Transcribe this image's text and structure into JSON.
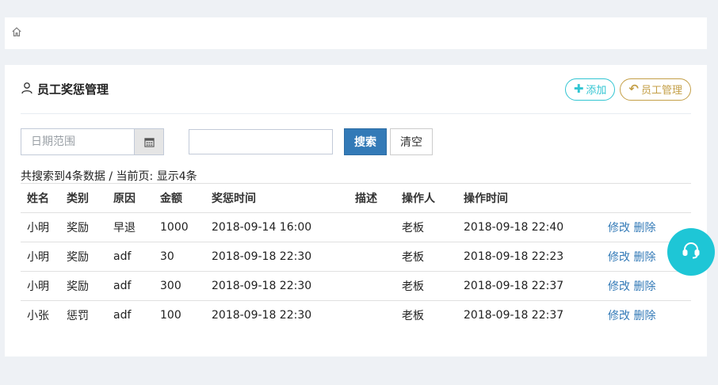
{
  "breadcrumb": {
    "home_icon": "home-icon"
  },
  "panel": {
    "title": "员工奖惩管理",
    "title_icon": "user-icon",
    "actions": {
      "add_label": "添加",
      "staff_label": "员工管理"
    }
  },
  "search": {
    "date_placeholder": "日期范围",
    "text_value": "",
    "search_label": "搜索",
    "clear_label": "清空"
  },
  "summary": "共搜索到4条数据 / 当前页: 显示4条",
  "table": {
    "headers": [
      "姓名",
      "类别",
      "原因",
      "金额",
      "奖惩时间",
      "描述",
      "操作人",
      "操作时间",
      ""
    ],
    "rows": [
      {
        "name": "小明",
        "type": "奖励",
        "reason": "早退",
        "amount": "1000",
        "time": "2018-09-14 16:00",
        "desc": "",
        "operator": "老板",
        "op_time": "2018-09-18 22:40",
        "edit": "修改",
        "delete": "删除"
      },
      {
        "name": "小明",
        "type": "奖励",
        "reason": "adf",
        "amount": "30",
        "time": "2018-09-18 22:30",
        "desc": "",
        "operator": "老板",
        "op_time": "2018-09-18 22:23",
        "edit": "修改",
        "delete": "删除"
      },
      {
        "name": "小明",
        "type": "奖励",
        "reason": "adf",
        "amount": "300",
        "time": "2018-09-18 22:30",
        "desc": "",
        "operator": "老板",
        "op_time": "2018-09-18 22:37",
        "edit": "修改",
        "delete": "删除"
      },
      {
        "name": "小张",
        "type": "惩罚",
        "reason": "adf",
        "amount": "100",
        "time": "2018-09-18 22:30",
        "desc": "",
        "operator": "老板",
        "op_time": "2018-09-18 22:37",
        "edit": "修改",
        "delete": "删除"
      }
    ]
  },
  "colors": {
    "add_accent": "#32c5d2",
    "staff_accent": "#c49f47",
    "primary": "#337ab7",
    "support_button": "#1ec6d6"
  },
  "support_icon": "headset-icon"
}
